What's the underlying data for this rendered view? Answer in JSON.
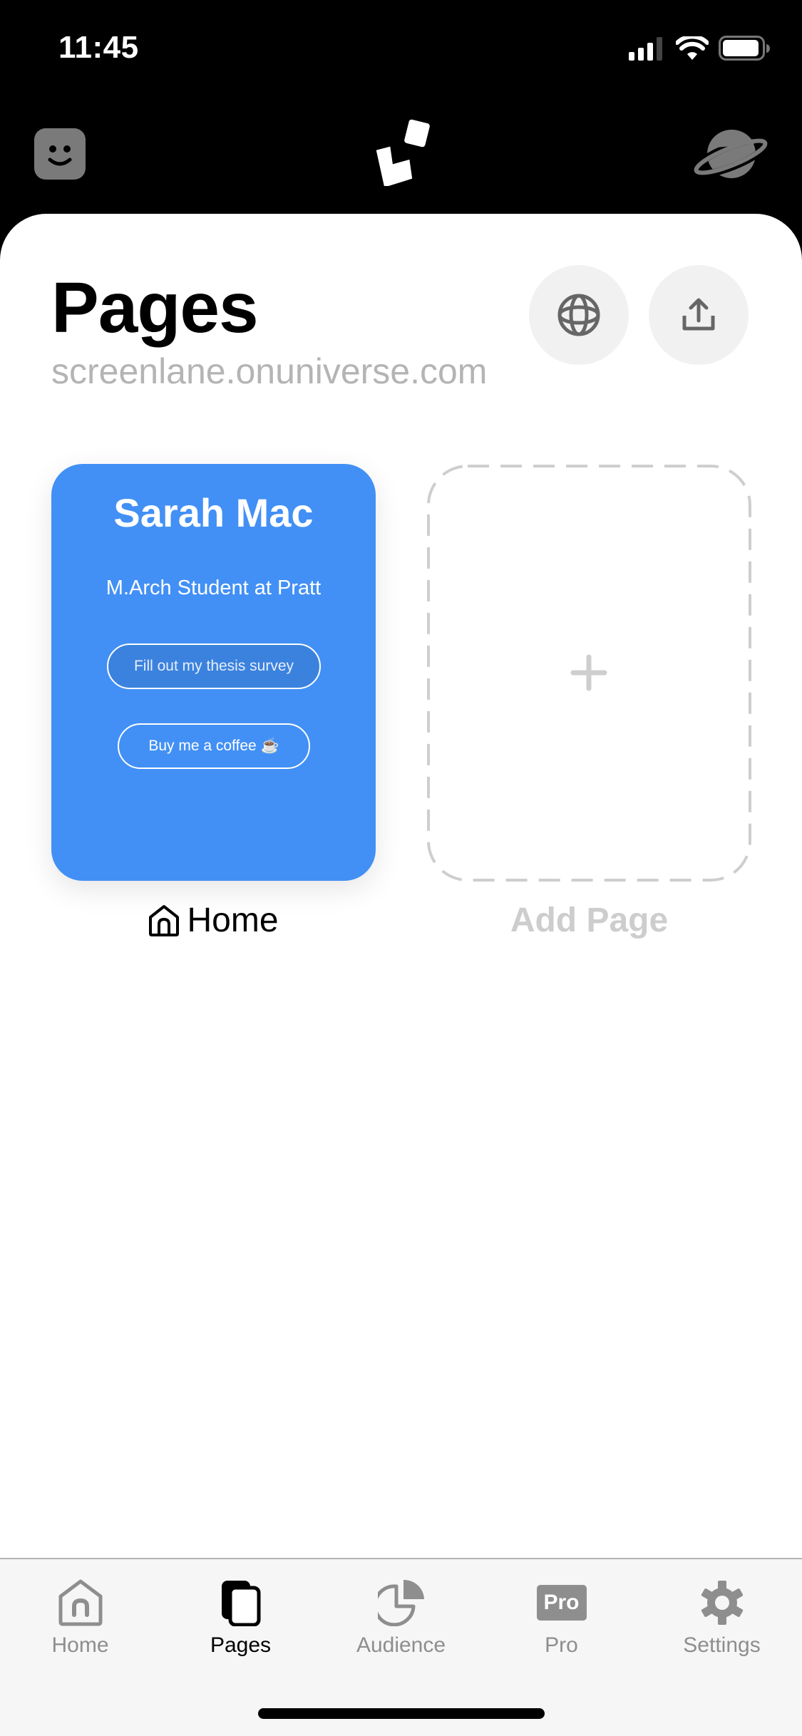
{
  "status_bar": {
    "time": "11:45",
    "icons": [
      "cellular-signal-icon",
      "wifi-icon",
      "battery-icon"
    ]
  },
  "top_nav": {
    "left_icon": "smiley-face-icon",
    "center_logo": "app-logo",
    "right_icon": "planet-icon"
  },
  "header": {
    "title": "Pages",
    "subtitle": "screenlane.onuniverse.com",
    "actions": [
      {
        "icon": "globe-icon",
        "label": "View site"
      },
      {
        "icon": "share-icon",
        "label": "Share"
      }
    ]
  },
  "pages": [
    {
      "label": "Home",
      "icon": "home-icon",
      "preview": {
        "name": "Sarah Mac",
        "bio": "M.Arch Student at Pratt",
        "links": [
          "Fill out my thesis survey",
          "Buy me a coffee ☕"
        ],
        "background_color": "#4290f5"
      }
    }
  ],
  "add_page": {
    "label": "Add Page",
    "icon": "plus-icon"
  },
  "tab_bar": {
    "active": "Pages",
    "tabs": [
      {
        "label": "Home",
        "icon": "home-icon"
      },
      {
        "label": "Pages",
        "icon": "pages-icon"
      },
      {
        "label": "Audience",
        "icon": "pie-chart-icon"
      },
      {
        "label": "Pro",
        "icon": "pro-badge-icon",
        "badge_text": "Pro"
      },
      {
        "label": "Settings",
        "icon": "gear-icon"
      }
    ]
  },
  "colors": {
    "accent": "#4290f5",
    "muted_text": "#b4b4b4",
    "tab_inactive": "#8e8e8e",
    "button_bg": "#f1f1f1"
  }
}
